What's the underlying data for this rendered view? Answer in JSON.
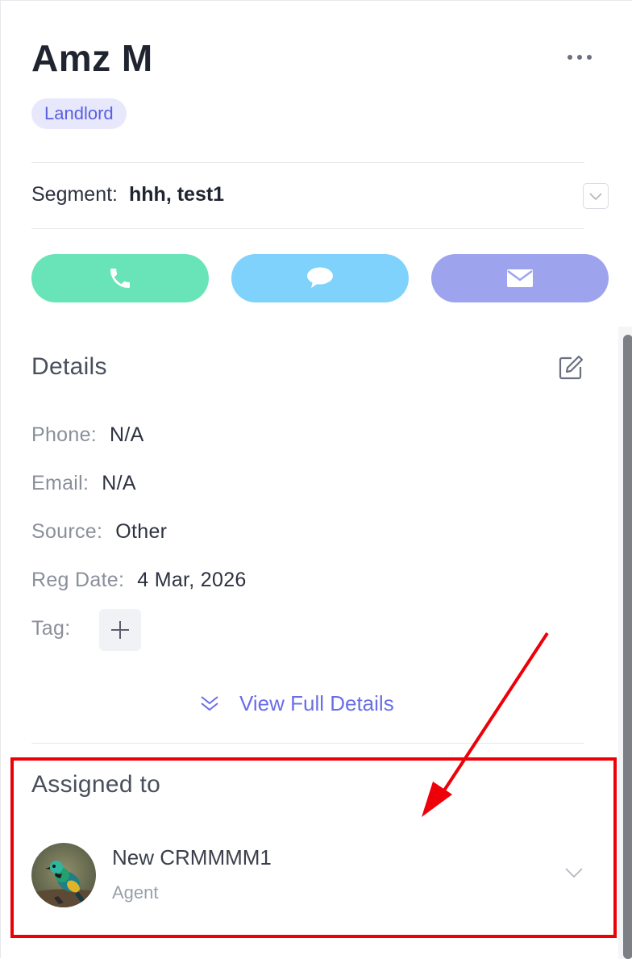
{
  "contact": {
    "name": "Amz M",
    "role_badge": "Landlord"
  },
  "segment": {
    "label": "Segment:",
    "value": "hhh, test1"
  },
  "actions": {
    "call": "phone-icon",
    "chat": "chat-bubble-icon",
    "email": "mail-icon"
  },
  "details": {
    "title": "Details",
    "fields": [
      {
        "label": "Phone:",
        "value": "N/A"
      },
      {
        "label": "Email:",
        "value": "N/A"
      },
      {
        "label": "Source:",
        "value": "Other"
      },
      {
        "label": "Reg Date:",
        "value": "4 Mar, 2026"
      },
      {
        "label": "Tag:",
        "value": ""
      }
    ],
    "view_full_label": "View Full Details"
  },
  "assigned": {
    "title": "Assigned to",
    "agent_name": "New CRMMMM1",
    "agent_role": "Agent"
  },
  "colors": {
    "call": "#68e4b8",
    "chat": "#7fd2fb",
    "email": "#9ea3ee",
    "accent": "#6a6ee8",
    "annotation": "#ee0008"
  }
}
